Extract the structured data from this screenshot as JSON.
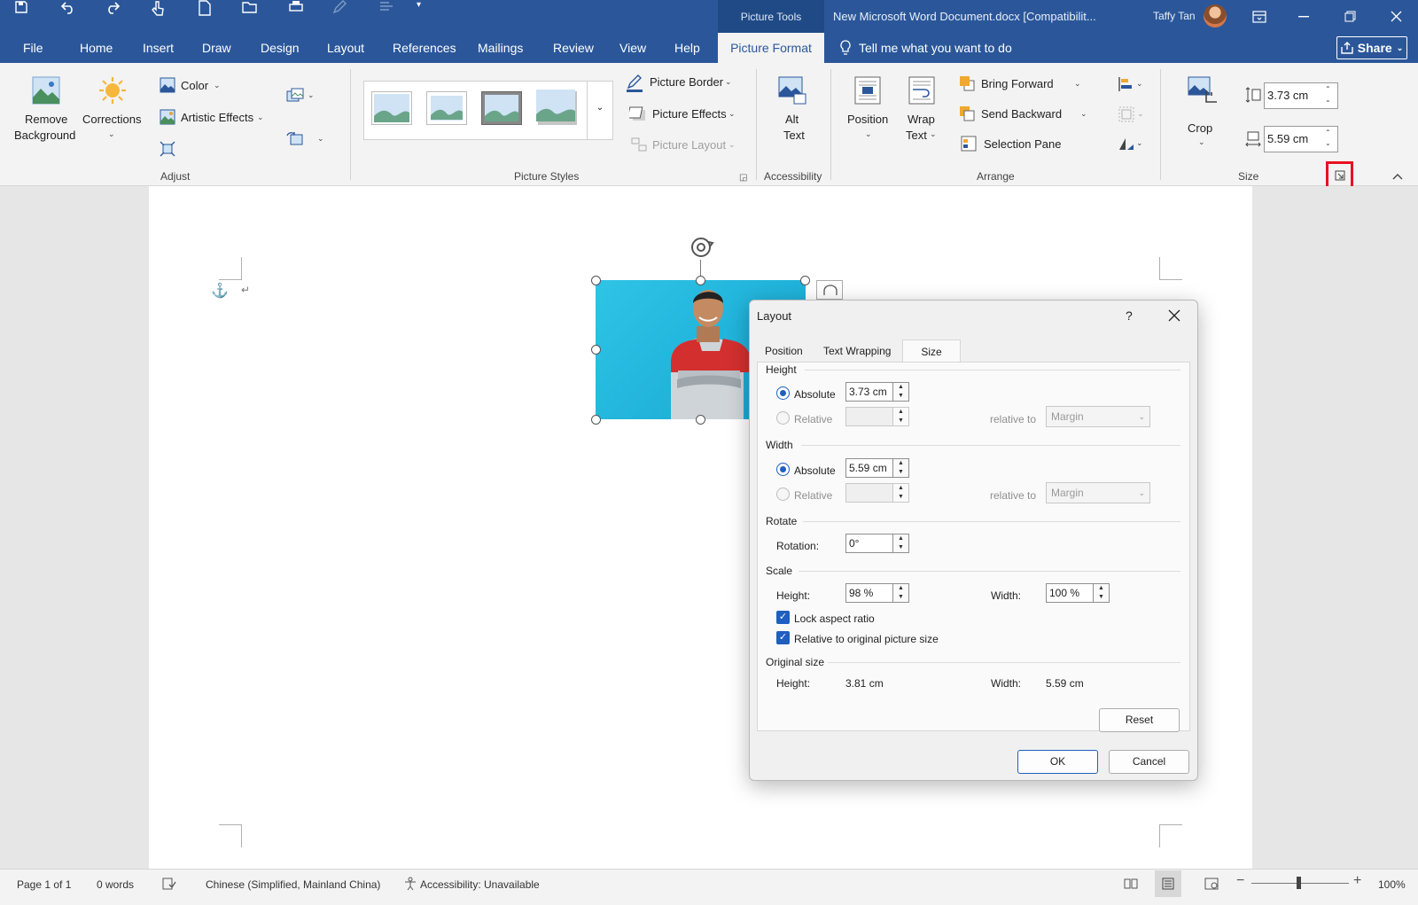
{
  "titlebar": {
    "context_tools": "Picture Tools",
    "document_title": "New Microsoft Word Document.docx [Compatibilit...",
    "user_name": "Taffy Tan"
  },
  "tabs": [
    "File",
    "Home",
    "Insert",
    "Draw",
    "Design",
    "Layout",
    "References",
    "Mailings",
    "Review",
    "View",
    "Help"
  ],
  "active_tab": "Picture Format",
  "tell_me": "Tell me what you want to do",
  "share": "Share",
  "ribbon": {
    "adjust": {
      "remove_background_1": "Remove",
      "remove_background_2": "Background",
      "corrections": "Corrections",
      "color": "Color",
      "artistic_effects": "Artistic Effects",
      "group": "Adjust"
    },
    "styles": {
      "picture_border": "Picture Border",
      "picture_effects": "Picture Effects",
      "picture_layout": "Picture Layout",
      "group": "Picture Styles"
    },
    "accessibility": {
      "alt_1": "Alt",
      "alt_2": "Text",
      "group": "Accessibility"
    },
    "arrange": {
      "position": "Position",
      "wrap_1": "Wrap",
      "wrap_2": "Text",
      "bring_forward": "Bring Forward",
      "send_backward": "Send Backward",
      "selection_pane": "Selection Pane",
      "group": "Arrange"
    },
    "size": {
      "crop": "Crop",
      "height": "3.73 cm",
      "width": "5.59 cm",
      "group": "Size"
    }
  },
  "dialog": {
    "title": "Layout",
    "help": "?",
    "tabs": [
      "Position",
      "Text Wrapping",
      "Size"
    ],
    "active_tab": "Size",
    "height_section": "Height",
    "width_section": "Width",
    "absolute": "Absolute",
    "relative": "Relative",
    "relative_to": "relative to",
    "margin": "Margin",
    "height_abs_value": "3.73 cm",
    "width_abs_value": "5.59 cm",
    "rotate_section": "Rotate",
    "rotation_label": "Rotation:",
    "rotation_value": "0°",
    "scale_section": "Scale",
    "scale_height_label": "Height:",
    "scale_height_value": "98 %",
    "scale_width_label": "Width:",
    "scale_width_value": "100 %",
    "lock_aspect": "Lock aspect ratio",
    "relative_original": "Relative to original picture size",
    "original_section": "Original size",
    "orig_height_label": "Height:",
    "orig_height_value": "3.81 cm",
    "orig_width_label": "Width:",
    "orig_width_value": "5.59 cm",
    "reset": "Reset",
    "ok": "OK",
    "cancel": "Cancel"
  },
  "status": {
    "page": "Page 1 of 1",
    "words": "0 words",
    "language": "Chinese (Simplified, Mainland China)",
    "accessibility": "Accessibility: Unavailable",
    "zoom": "100%"
  },
  "colors": {
    "brand": "#2b579a",
    "highlight": "#e81123",
    "accent": "#1f5fbf"
  }
}
